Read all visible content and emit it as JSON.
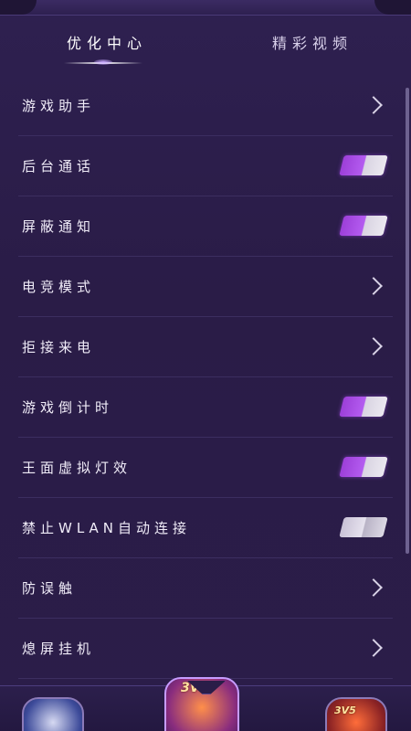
{
  "tabs": {
    "active": "优化中心",
    "inactive": "精彩视频"
  },
  "settings": [
    {
      "label": "游戏助手",
      "control": "chevron"
    },
    {
      "label": "后台通话",
      "control": "toggle",
      "on": true
    },
    {
      "label": "屏蔽通知",
      "control": "toggle",
      "on": true
    },
    {
      "label": "电竞模式",
      "control": "chevron"
    },
    {
      "label": "拒接来电",
      "control": "chevron"
    },
    {
      "label": "游戏倒计时",
      "control": "toggle",
      "on": true
    },
    {
      "label": "王面虚拟灯效",
      "control": "toggle",
      "on": true
    },
    {
      "label": "禁止WLAN自动连接",
      "control": "toggle",
      "on": false
    },
    {
      "label": "防误触",
      "control": "chevron"
    },
    {
      "label": "熄屏挂机",
      "control": "chevron"
    }
  ],
  "bottom_games": {
    "center_badge": "3V5",
    "right_badge": "3V5"
  },
  "colors": {
    "background": "#2b1d4a",
    "toggle_on": "#9c3fd8",
    "divider": "#3c2e60"
  }
}
